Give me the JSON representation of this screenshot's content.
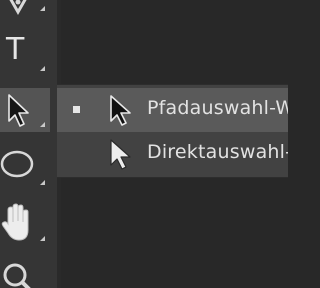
{
  "toolbar": {
    "tools": [
      {
        "icon": "pen-tool-icon"
      },
      {
        "icon": "type-tool-icon",
        "glyph": "T"
      },
      {
        "icon": "path-selection-tool-icon",
        "active": true
      },
      {
        "icon": "ellipse-tool-icon"
      },
      {
        "icon": "hand-tool-icon"
      },
      {
        "icon": "zoom-tool-icon"
      }
    ]
  },
  "flyout": {
    "items": [
      {
        "label": "Pfadauswahl-Werkzeug",
        "icon": "black-arrow-icon",
        "selected": true
      },
      {
        "label": "Direktauswahl-Werkzeug",
        "icon": "white-arrow-icon",
        "selected": false
      }
    ]
  },
  "colors": {
    "panel": "#353535",
    "active_tool": "#545454",
    "flyout_bg": "#424242",
    "flyout_selected": "#5a5a5a",
    "text": "#e2e2e2"
  }
}
